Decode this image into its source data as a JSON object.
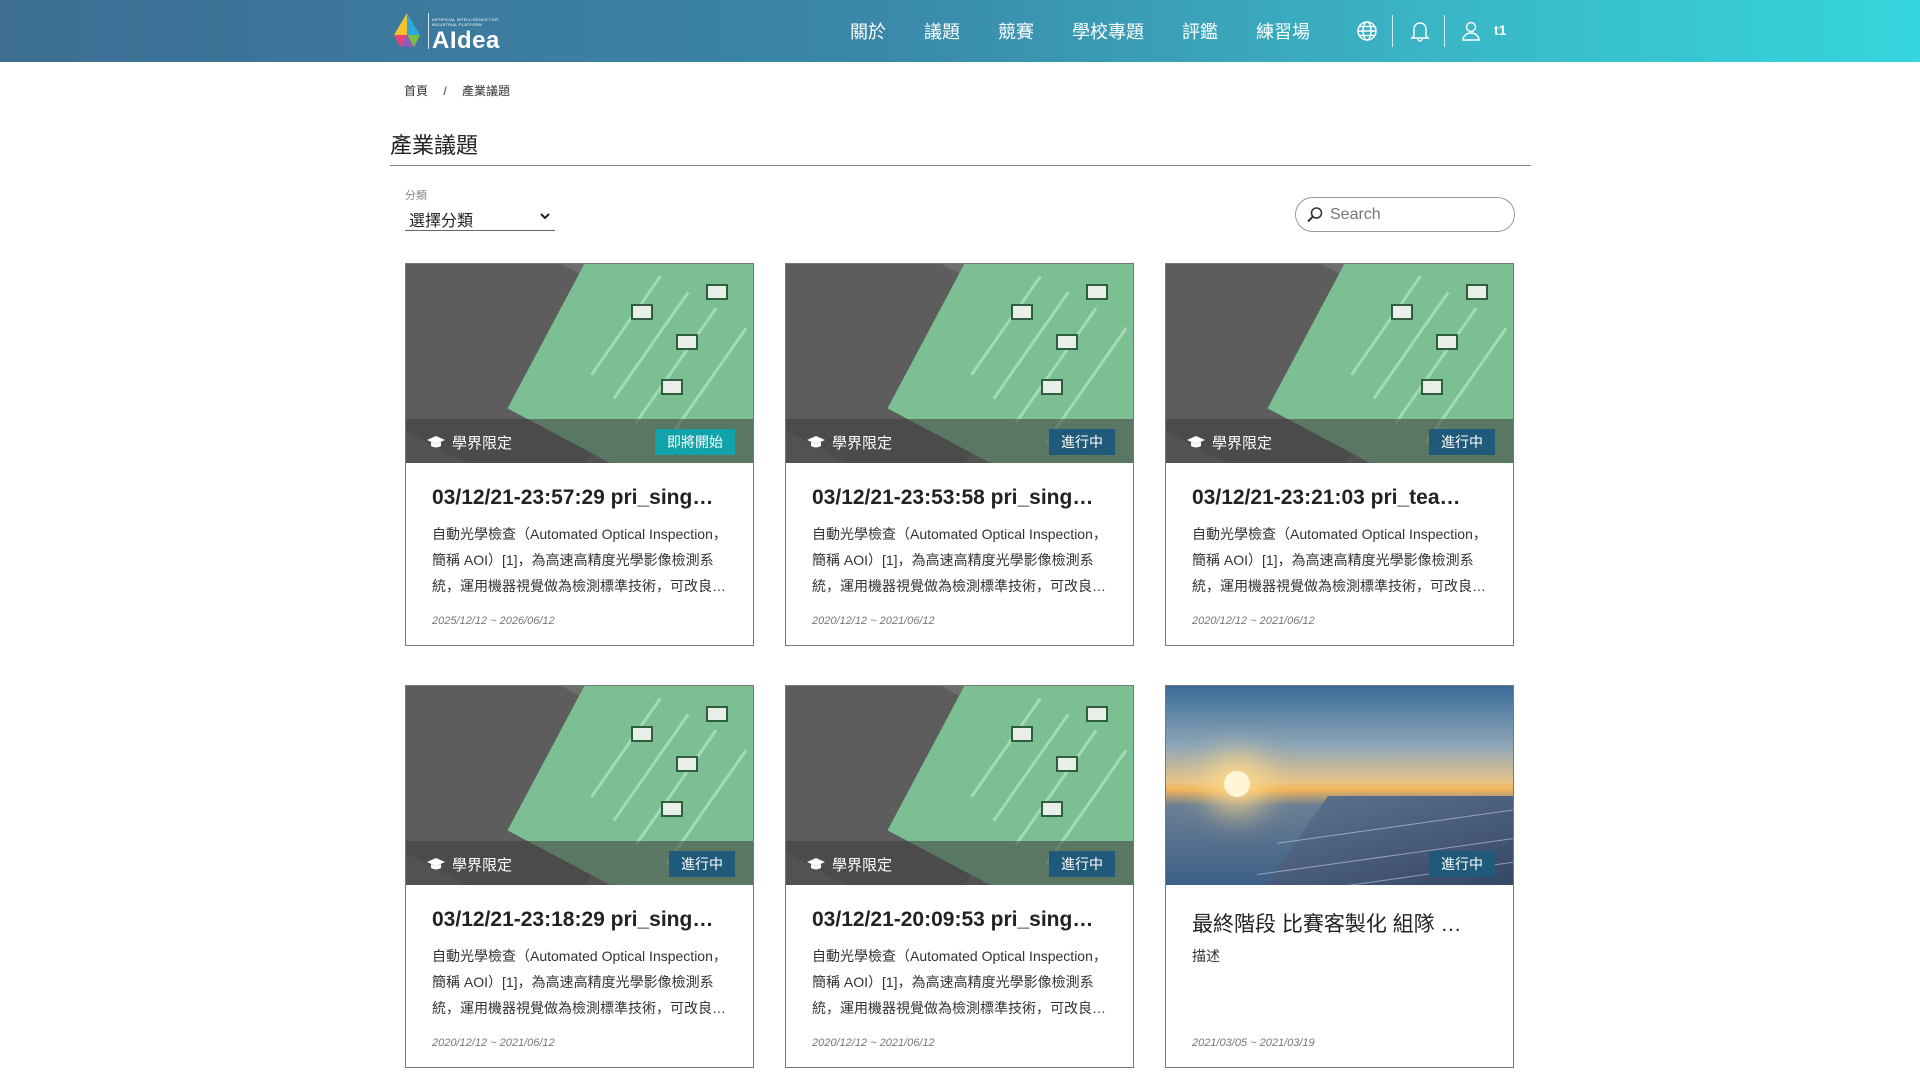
{
  "header": {
    "logo_text": "AIdea",
    "logo_sub": "ARTIFICIAL INTELLIGENCE FOR INDUSTRIAL PLATFORM",
    "nav": [
      "關於",
      "議題",
      "競賽",
      "學校專題",
      "評鑑",
      "練習場"
    ],
    "icons": [
      "globe-icon",
      "bell-icon",
      "user-icon"
    ],
    "user_name": "t1",
    "colors": {
      "gradient_start": "#3d6d93",
      "gradient_end": "#35d6dd"
    }
  },
  "breadcrumb": {
    "home": "首頁",
    "separator": "/",
    "current": "產業議題"
  },
  "page": {
    "title": "產業議題"
  },
  "filter": {
    "category_label": "分類",
    "category_value": "選擇分類"
  },
  "search": {
    "placeholder": "Search"
  },
  "cards": [
    {
      "tag": "學界限定",
      "status": "即將開始",
      "status_color": "#12a3aa",
      "image": "pcb",
      "title": "03/12/21-23:57:29 pri_sing…",
      "desc": "自動光學檢查（Automated Optical Inspection，簡稱 AOI）[1]，為高速高精度光學影像檢測系統，運用機器視覺做為檢測標準技術，可改良…",
      "date": "2025/12/12 ~ 2026/06/12"
    },
    {
      "tag": "學界限定",
      "status": "進行中",
      "status_color": "#1f5a7a",
      "image": "pcb",
      "title": "03/12/21-23:53:58 pri_sing…",
      "desc": "自動光學檢查（Automated Optical Inspection，簡稱 AOI）[1]，為高速高精度光學影像檢測系統，運用機器視覺做為檢測標準技術，可改良…",
      "date": "2020/12/12 ~ 2021/06/12"
    },
    {
      "tag": "學界限定",
      "status": "進行中",
      "status_color": "#1f5a7a",
      "image": "pcb",
      "title": "03/12/21-23:21:03 pri_tea…",
      "desc": "自動光學檢查（Automated Optical Inspection，簡稱 AOI）[1]，為高速高精度光學影像檢測系統，運用機器視覺做為檢測標準技術，可改良…",
      "date": "2020/12/12 ~ 2021/06/12"
    },
    {
      "tag": "學界限定",
      "status": "進行中",
      "status_color": "#1f5a7a",
      "image": "pcb",
      "title": "03/12/21-23:18:29 pri_sing…",
      "desc": "自動光學檢查（Automated Optical Inspection，簡稱 AOI）[1]，為高速高精度光學影像檢測系統，運用機器視覺做為檢測標準技術，可改良…",
      "date": "2020/12/12 ~ 2021/06/12"
    },
    {
      "tag": "學界限定",
      "status": "進行中",
      "status_color": "#1f5a7a",
      "image": "pcb",
      "title": "03/12/21-20:09:53 pri_sing…",
      "desc": "自動光學檢查（Automated Optical Inspection，簡稱 AOI）[1]，為高速高精度光學影像檢測系統，運用機器視覺做為檢測標準技術，可改良…",
      "date": "2020/12/12 ~ 2021/06/12"
    },
    {
      "tag": "",
      "status": "進行中",
      "status_color": "#1f5a7a",
      "image": "solar",
      "title": "最終階段 比賽客製化 組隊 …",
      "desc": "描述",
      "date": "2021/03/05 ~ 2021/03/19"
    }
  ]
}
